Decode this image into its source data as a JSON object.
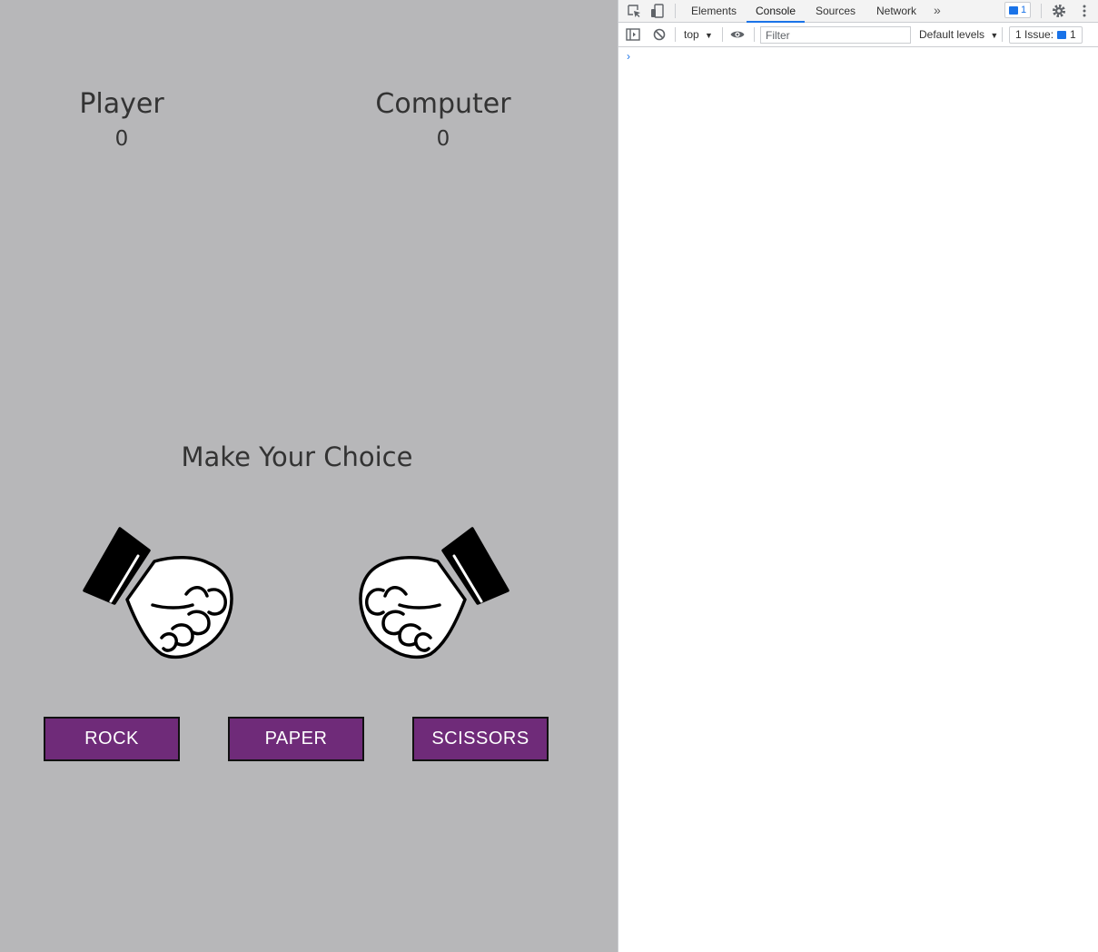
{
  "game": {
    "player_label": "Player",
    "player_score": "0",
    "computer_label": "Computer",
    "computer_score": "0",
    "prompt": "Make Your Choice",
    "hands": {
      "player": "fist-icon",
      "computer": "fist-icon"
    },
    "buttons": {
      "rock": "ROCK",
      "paper": "PAPER",
      "scissors": "SCISSORS"
    },
    "colors": {
      "background": "#b7b7b9",
      "button": "#6f2b79",
      "text": "#333333"
    }
  },
  "devtools": {
    "tabs": [
      "Elements",
      "Console",
      "Sources",
      "Network"
    ],
    "active_tab": "Console",
    "more_tabs": "»",
    "message_badge_count": "1",
    "context": "top",
    "filter_placeholder": "Filter",
    "levels": "Default levels",
    "issues_label": "1 Issue:",
    "issues_count": "1",
    "console_prompt": "›"
  }
}
